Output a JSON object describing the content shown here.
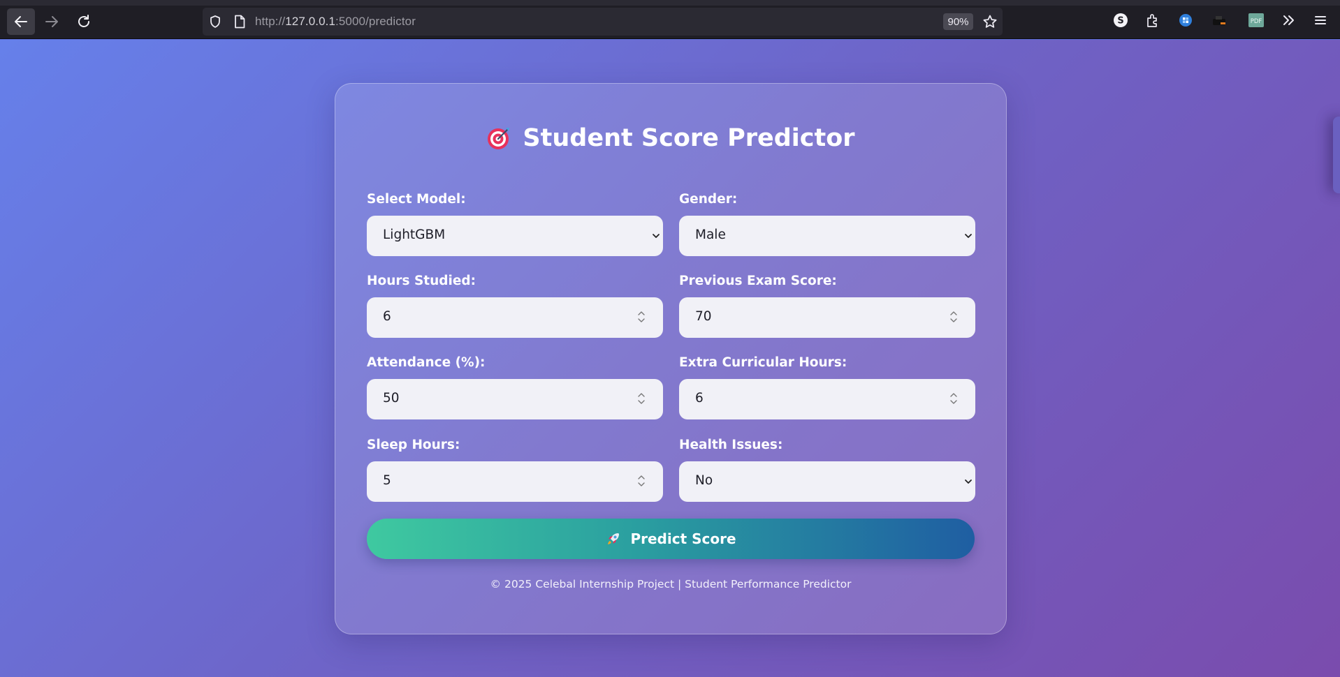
{
  "browser": {
    "url_prefix": "http://",
    "url_host": "127.0.0.1",
    "url_path": ":5000/predictor",
    "zoom": "90%"
  },
  "page": {
    "title": "Student Score Predictor",
    "title_icon": "target-icon",
    "fields": {
      "model": {
        "label": "Select Model:",
        "value": "LightGBM"
      },
      "gender": {
        "label": "Gender:",
        "value": "Male"
      },
      "hours_studied": {
        "label": "Hours Studied:",
        "value": "6"
      },
      "previous_exam_score": {
        "label": "Previous Exam Score:",
        "value": "70"
      },
      "attendance": {
        "label": "Attendance (%):",
        "value": "50"
      },
      "extra_curricular_hours": {
        "label": "Extra Curricular Hours:",
        "value": "6"
      },
      "sleep_hours": {
        "label": "Sleep Hours:",
        "value": "5"
      },
      "health_issues": {
        "label": "Health Issues:",
        "value": "No"
      }
    },
    "predict_button": {
      "label": "Predict Score",
      "icon": "rocket-icon"
    },
    "footer": "© 2025 Celebal Internship Project | Student Performance Predictor"
  },
  "colors": {
    "bg_start": "#6680ea",
    "bg_end": "#7a4cad",
    "button_start": "#3fc9a0",
    "button_end": "#1f5ea2"
  }
}
